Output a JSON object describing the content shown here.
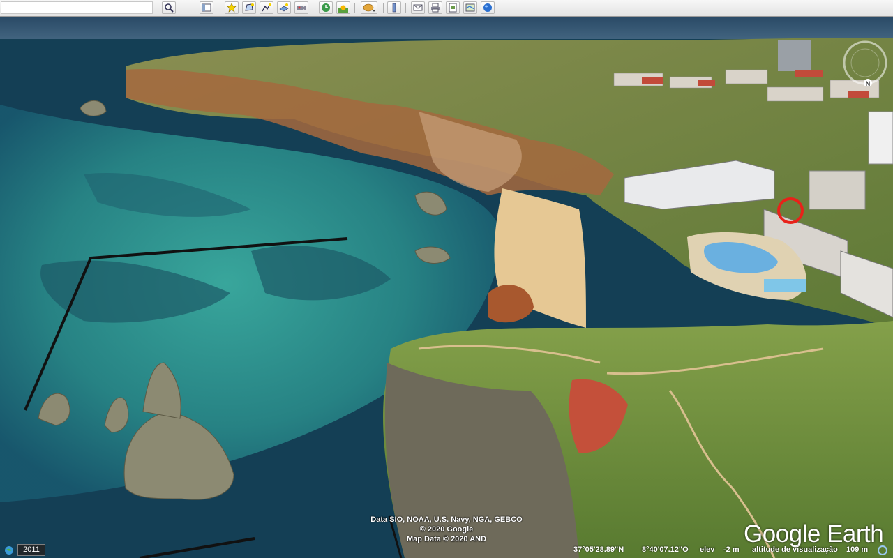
{
  "toolbar": {
    "search_placeholder": "",
    "buttons": [
      {
        "name": "search-icon"
      },
      {
        "name": "sidebar-toggle-icon"
      },
      {
        "name": "placemark-icon"
      },
      {
        "name": "polygon-icon"
      },
      {
        "name": "path-icon"
      },
      {
        "name": "image-overlay-icon"
      },
      {
        "name": "record-tour-icon"
      },
      {
        "name": "historical-imagery-icon"
      },
      {
        "name": "sunlight-icon"
      },
      {
        "name": "planets-icon"
      },
      {
        "name": "ruler-icon"
      },
      {
        "name": "email-icon"
      },
      {
        "name": "print-icon"
      },
      {
        "name": "save-image-icon"
      },
      {
        "name": "view-in-maps-icon"
      },
      {
        "name": "globe-icon"
      }
    ]
  },
  "compass": {
    "north_label": "N"
  },
  "map": {
    "marker_color": "#e8221a",
    "credits": [
      "Data SIO, NOAA, U.S. Navy, NGA, GEBCO",
      "© 2020 Google",
      "Map Data © 2020 AND"
    ],
    "logo": "Google Earth"
  },
  "status": {
    "imagery_year": "2011",
    "latitude": "37°05'28.89\"N",
    "longitude": "8°40'07.12\"O",
    "elev_label": "elev",
    "elev_value": "-2 m",
    "view_altitude_label": "altitude de visualização",
    "view_altitude_value": "109 m"
  },
  "colors": {
    "ocean_deep": "#123b52",
    "ocean_shallow": "#2fa39a",
    "sand": "#e2c48f",
    "cliff": "#b06a40",
    "vegetation": "#6e8a3f"
  }
}
